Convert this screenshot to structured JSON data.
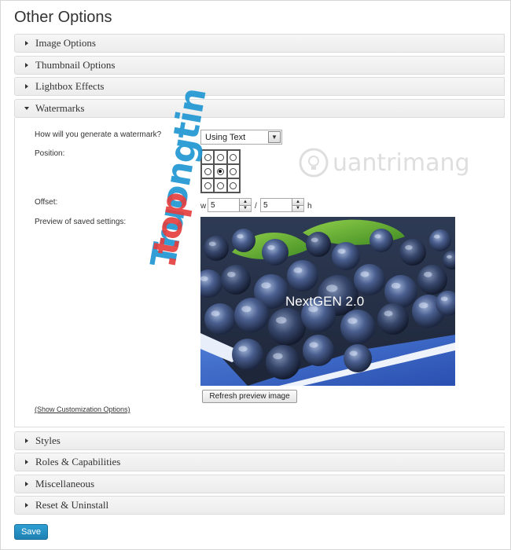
{
  "page": {
    "title": "Other Options"
  },
  "sections_top": [
    {
      "label": "Image Options",
      "open": false
    },
    {
      "label": "Thumbnail Options",
      "open": false
    },
    {
      "label": "Lightbox Effects",
      "open": false
    },
    {
      "label": "Watermarks",
      "open": true
    }
  ],
  "watermarks": {
    "generate_label": "How will you generate a watermark?",
    "generate_value": "Using Text",
    "position_label": "Position:",
    "position_selected": [
      1,
      1
    ],
    "offset_label": "Offset:",
    "offset_w_prefix": "w",
    "offset_w": "5",
    "offset_sep": "/",
    "offset_h": "5",
    "offset_h_suffix": "h",
    "preview_label": "Preview of saved settings:",
    "preview_watermark_text": "NextGEN 2.0",
    "refresh_label": "Refresh preview image",
    "customization_link": "(Show Customization Options)"
  },
  "sections_bottom": [
    {
      "label": "Styles"
    },
    {
      "label": "Roles & Capabilities"
    },
    {
      "label": "Miscellaneous"
    },
    {
      "label": "Reset & Uninstall"
    }
  ],
  "footer": {
    "save_label": "Save"
  },
  "overlay_watermarks": {
    "diagonal_text": "Truongtin",
    "diagonal_dot": ".top",
    "brand_text": "uantrimang"
  },
  "colors": {
    "accent": "#2e9fd2",
    "header_bg": "#f1f1f1",
    "border": "#dcdcdc"
  }
}
